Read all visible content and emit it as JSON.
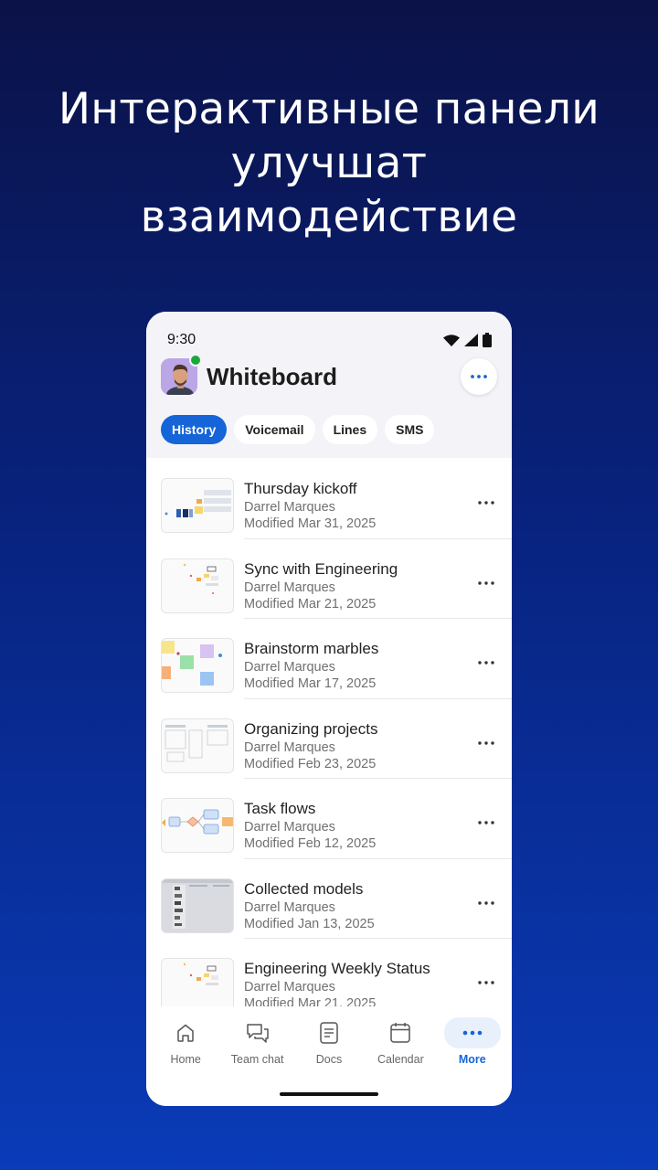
{
  "headline": {
    "line1": "Интерактивные панели",
    "line2": "улучшат",
    "line3": "взаимодействие"
  },
  "status_bar": {
    "time": "9:30"
  },
  "header": {
    "title": "Whiteboard",
    "more_icon": "ellipsis-icon"
  },
  "tabs": [
    {
      "label": "History",
      "active": true
    },
    {
      "label": "Voicemail",
      "active": false
    },
    {
      "label": "Lines",
      "active": false
    },
    {
      "label": "SMS",
      "active": false
    }
  ],
  "items": [
    {
      "title": "Thursday kickoff",
      "author": "Darrel Marques",
      "modified": "Modified Mar 31, 2025"
    },
    {
      "title": "Sync with Engineering",
      "author": "Darrel Marques",
      "modified": "Modified Mar 21, 2025"
    },
    {
      "title": "Brainstorm marbles",
      "author": "Darrel Marques",
      "modified": "Modified Mar 17, 2025"
    },
    {
      "title": "Organizing projects",
      "author": "Darrel Marques",
      "modified": "Modified Feb 23, 2025"
    },
    {
      "title": "Task flows",
      "author": "Darrel Marques",
      "modified": "Modified Feb 12, 2025"
    },
    {
      "title": "Collected models",
      "author": "Darrel Marques",
      "modified": "Modified Jan 13, 2025"
    },
    {
      "title": "Engineering Weekly Status",
      "author": "Darrel Marques",
      "modified": "Modified Mar 21, 2025"
    }
  ],
  "nav": [
    {
      "label": "Home",
      "icon": "home-icon"
    },
    {
      "label": "Team chat",
      "icon": "chat-icon"
    },
    {
      "label": "Docs",
      "icon": "document-icon"
    },
    {
      "label": "Calendar",
      "icon": "calendar-icon"
    },
    {
      "label": "More",
      "icon": "ellipsis-icon",
      "active": true
    }
  ],
  "colors": {
    "accent": "#1565d8",
    "presence": "#1aa83a"
  }
}
